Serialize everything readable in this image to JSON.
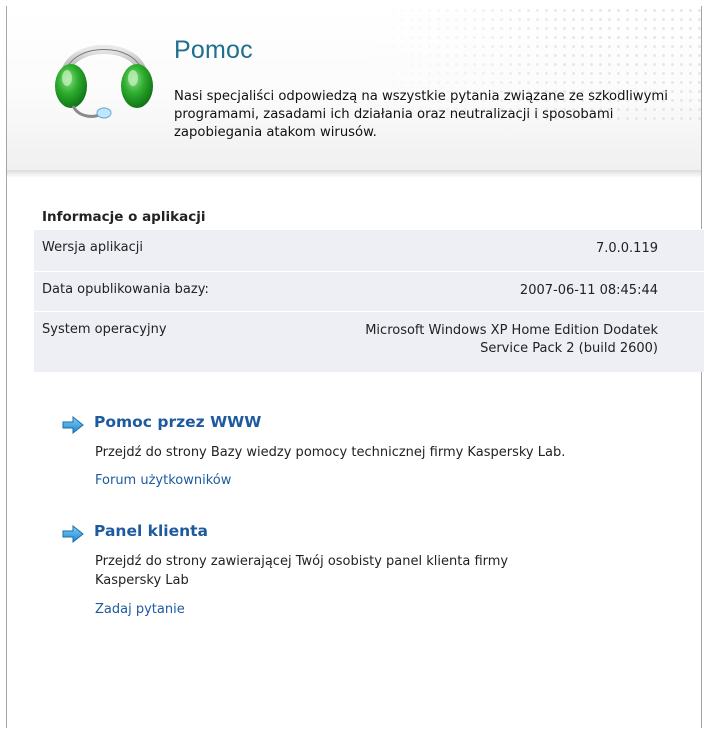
{
  "header": {
    "title": "Pomoc",
    "description": "Nasi specjaliści odpowiedzą na wszystkie pytania związane ze szkodliwymi programami, zasadami ich działania oraz neutralizacji i sposobami zapobiegania atakom wirusów.",
    "logo_icon": "headset-icon"
  },
  "app_info": {
    "heading": "Informacje o aplikacji",
    "rows": [
      {
        "label": "Wersja aplikacji",
        "value": "7.0.0.119"
      },
      {
        "label": "Data opublikowania bazy:",
        "value": "2007-06-11 08:45:44"
      },
      {
        "label": "System operacyjny",
        "value_line1": "Microsoft Windows XP Home Edition Dodatek",
        "value_line2": "Service Pack 2 (build 2600)"
      }
    ]
  },
  "sections": [
    {
      "icon": "arrow-right-icon",
      "title": "Pomoc przez WWW",
      "text": "Przejdź do strony Bazy wiedzy pomocy technicznej firmy Kaspersky Lab.",
      "link": "Forum użytkowników"
    },
    {
      "icon": "arrow-right-icon",
      "title": "Panel klienta",
      "text_line1": "Przejdź do strony zawierającej Twój osobisty panel klienta firmy",
      "text_line2": "Kaspersky Lab",
      "link": "Zadaj pytanie"
    }
  ],
  "colors": {
    "title": "#1e6f90",
    "link": "#1e5a9e",
    "table_bg": "#eeeef5",
    "headset_green": "#1a9a2a"
  }
}
